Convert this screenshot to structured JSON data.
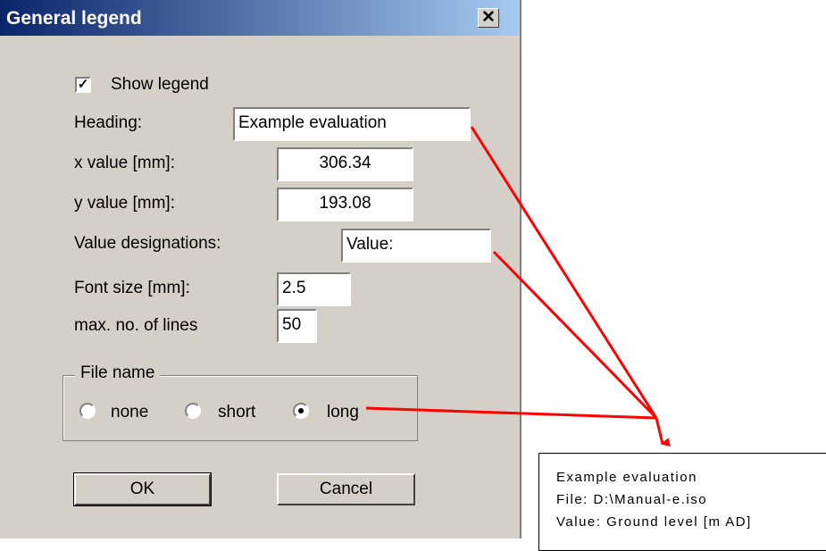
{
  "window": {
    "title": "General legend",
    "close_glyph": "✕"
  },
  "show_legend": {
    "label": "Show legend",
    "checked": true,
    "check_glyph": "✓"
  },
  "fields": {
    "heading": {
      "label": "Heading:",
      "value": "Example evaluation"
    },
    "x_value": {
      "label": "x value [mm]:",
      "value": "306.34"
    },
    "y_value": {
      "label": "y value [mm]:",
      "value": "193.08"
    },
    "value_designations": {
      "label": "Value designations:",
      "value": "Value:"
    },
    "font_size": {
      "label": "Font size [mm]:",
      "value": "2.5"
    },
    "max_lines": {
      "label": "max. no. of lines",
      "value": "50"
    }
  },
  "file_name_group": {
    "title": "File name",
    "options": [
      {
        "label": "none",
        "selected": false
      },
      {
        "label": "short",
        "selected": false
      },
      {
        "label": "long",
        "selected": true
      }
    ]
  },
  "buttons": {
    "ok": "OK",
    "cancel": "Cancel"
  },
  "legend_preview": {
    "lines": [
      "Example evaluation",
      "File: D:\\Manual-e.iso",
      "Value: Ground level [m AD]"
    ]
  },
  "colors": {
    "arrow": "#ff0000",
    "titlebar_start": "#0a246a",
    "titlebar_end": "#a6caf0",
    "dialog_bg": "#d4d0c8"
  }
}
